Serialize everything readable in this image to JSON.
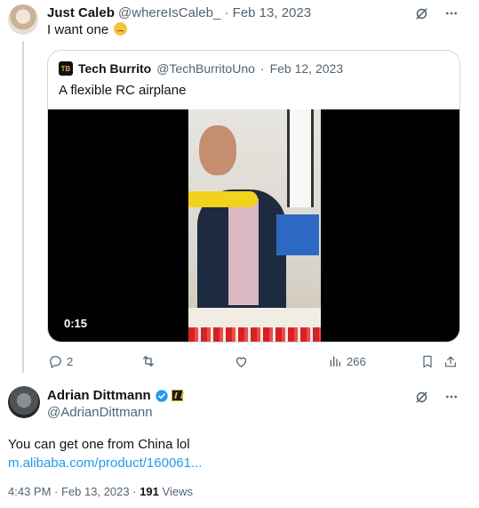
{
  "reply": {
    "name": "Just Caleb",
    "handle": "@whereIsCaleb_",
    "separator": "·",
    "date": "Feb 13, 2023",
    "text": "I want one"
  },
  "quote": {
    "name": "Tech Burrito",
    "handle": "@TechBurritoUno",
    "separator": "·",
    "date": "Feb 12, 2023",
    "text": "A flexible RC airplane",
    "video_duration": "0:15"
  },
  "actions": {
    "replies": "2",
    "reposts": "",
    "likes": "",
    "views": "266"
  },
  "main_tweet": {
    "name": "Adrian Dittmann",
    "handle": "@AdrianDittmann",
    "text": "You can get one from China lol",
    "link": "m.alibaba.com/product/160061...",
    "time": "4:43 PM",
    "date": "Feb 13, 2023",
    "views_count": "191",
    "views_label": "Views"
  },
  "colors": {
    "accent": "#1d9bf0",
    "muted": "#536471",
    "border": "#cfd9de"
  },
  "icons": {
    "grok": "grok-icon",
    "more": "more-icon",
    "reply": "reply-icon",
    "repost": "repost-icon",
    "like": "like-icon",
    "views": "views-icon",
    "bookmark": "bookmark-icon",
    "share": "share-icon",
    "verified": "verified-badge-icon"
  }
}
